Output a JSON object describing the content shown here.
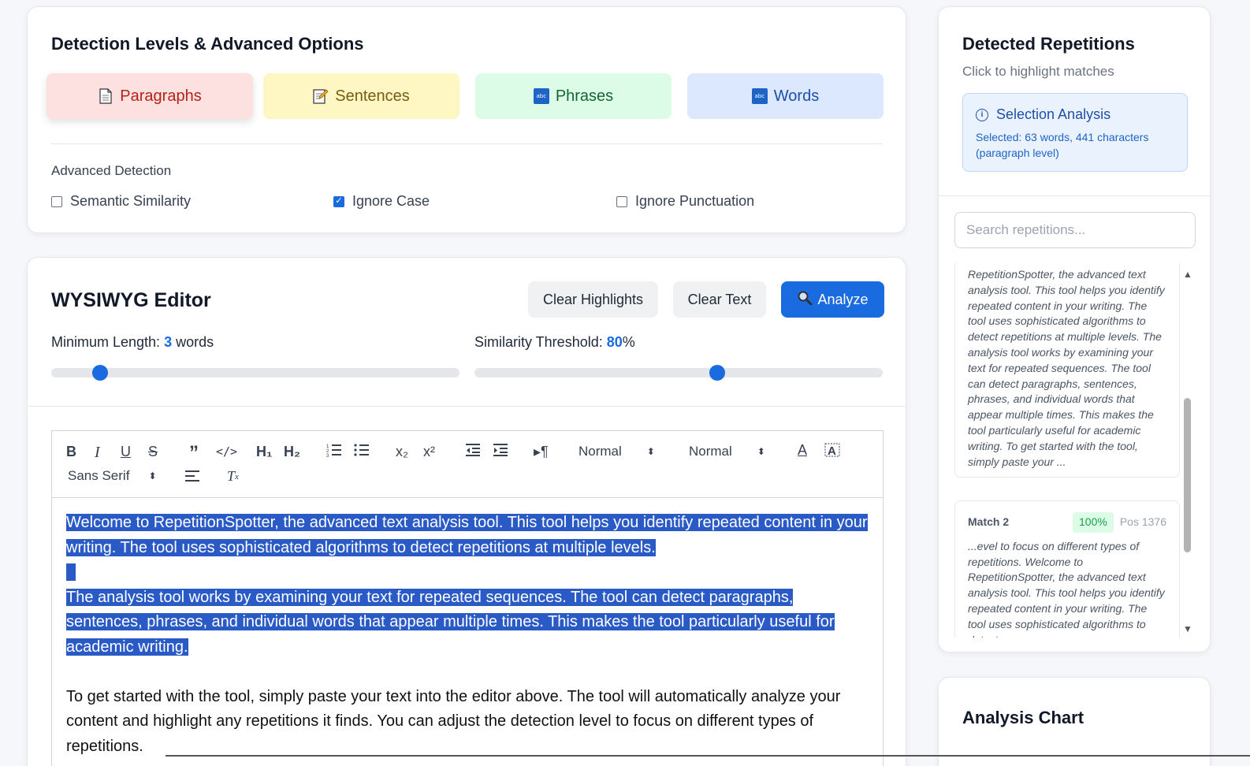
{
  "detection": {
    "title": "Detection Levels & Advanced Options",
    "levels": [
      {
        "label": "Paragraphs",
        "icon": "page-icon"
      },
      {
        "label": "Sentences",
        "icon": "memo-icon"
      },
      {
        "label": "Phrases",
        "icon": "abc-icon"
      },
      {
        "label": "Words",
        "icon": "abc-icon"
      }
    ],
    "active_level": "Paragraphs",
    "advanced_title": "Advanced Detection",
    "options": [
      {
        "label": "Semantic Similarity",
        "checked": false
      },
      {
        "label": "Ignore Case",
        "checked": true
      },
      {
        "label": "Ignore Punctuation",
        "checked": false
      }
    ]
  },
  "editor": {
    "title": "WYSIWYG Editor",
    "buttons": {
      "clear_highlights": "Clear Highlights",
      "clear_text": "Clear Text",
      "analyze": "Analyze"
    },
    "min_length": {
      "label": "Minimum Length: ",
      "value": "3",
      "unit": " words",
      "level": 0.12
    },
    "similarity": {
      "label": "Similarity Threshold: ",
      "value": "80",
      "unit": "%",
      "level": 0.595
    },
    "toolbar": {
      "header_select": "Normal",
      "size_select": "Normal",
      "font_select": "Sans Serif"
    },
    "paragraphs": [
      "Welcome to RepetitionSpotter, the advanced text analysis tool. This tool helps you identify repeated content in your writing. The tool uses sophisticated algorithms to detect repetitions at multiple levels.",
      "The analysis tool works by examining your text for repeated sequences. The tool can detect paragraphs, sentences, phrases, and individual words that appear multiple times. This makes the tool particularly useful for academic writing.",
      "To get started with the tool, simply paste your text into the editor above. The tool will automatically analyze your content and highlight any repetitions it finds. You can adjust the detection level to focus on different types of repetitions."
    ]
  },
  "repetitions": {
    "title": "Detected Repetitions",
    "subtitle": "Click to highlight matches",
    "selection": {
      "title": "Selection Analysis",
      "text": "Selected: 63 words, 441 characters (paragraph level)"
    },
    "search_placeholder": "Search repetitions...",
    "matches": [
      {
        "text": "RepetitionSpotter, the advanced text analysis tool. This tool helps you identify repeated content in your writing. The tool uses sophisticated algorithms to detect repetitions at multiple levels. The analysis tool works by examining your text for repeated sequences. The tool can detect paragraphs, sentences, phrases, and individual words that appear multiple times. This makes the tool particularly useful for academic writing. To get started with the tool, simply paste your ..."
      },
      {
        "name": "Match 2",
        "score": "100%",
        "pos": "Pos 1376",
        "text": "...evel to focus on different types of repetitions. Welcome to RepetitionSpotter, the advanced text analysis tool. This tool helps you identify repeated content in your writing. The tool uses sophisticated algorithms to detect..."
      }
    ]
  },
  "chart": {
    "title": "Analysis Chart"
  },
  "colors": {
    "accent": "#1a6ae0",
    "highlight": "#2a5ac6"
  }
}
